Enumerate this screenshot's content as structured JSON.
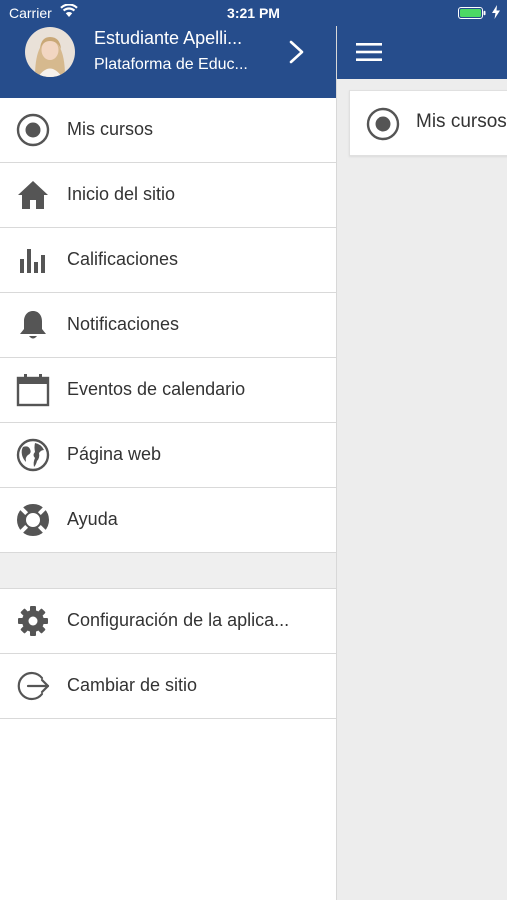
{
  "status_bar": {
    "carrier": "Carrier",
    "time": "3:21 PM"
  },
  "user": {
    "name": "Estudiante Apelli...",
    "site": "Plataforma de Educ..."
  },
  "menu": {
    "items": [
      {
        "label": "Mis cursos",
        "icon": "target-icon"
      },
      {
        "label": "Inicio del sitio",
        "icon": "home-icon"
      },
      {
        "label": "Calificaciones",
        "icon": "bar-chart-icon"
      },
      {
        "label": "Notificaciones",
        "icon": "bell-icon"
      },
      {
        "label": "Eventos de calendario",
        "icon": "calendar-icon"
      },
      {
        "label": "Página web",
        "icon": "globe-icon"
      },
      {
        "label": "Ayuda",
        "icon": "lifebuoy-icon"
      }
    ],
    "bottom_items": [
      {
        "label": "Configuración de la aplica...",
        "icon": "gear-icon"
      },
      {
        "label": "Cambiar de sitio",
        "icon": "logout-icon"
      }
    ]
  },
  "main": {
    "course_label": "Mis cursos"
  },
  "colors": {
    "header": "#264d8c",
    "icon": "#555555",
    "text": "#333333",
    "battery": "#4cd964"
  }
}
